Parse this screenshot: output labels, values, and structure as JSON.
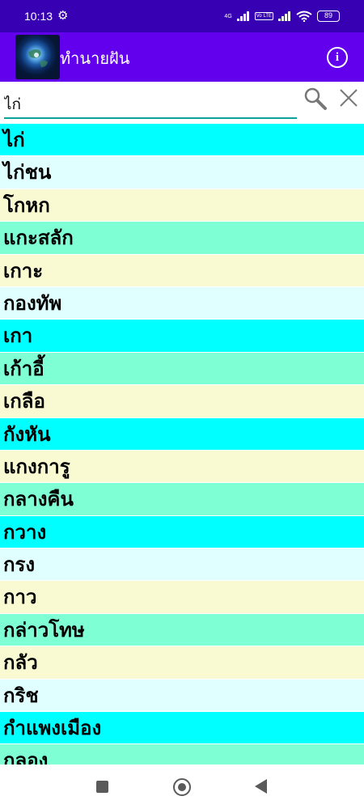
{
  "status_bar": {
    "time": "10:13",
    "gear_icon": "gear-icon",
    "network_label": "4G",
    "volte_label": "Vo LTE",
    "battery": "89"
  },
  "app_bar": {
    "title": "ทำนายฝัน",
    "info_icon": "info-icon",
    "info_glyph": "i",
    "logo_icon": "earth-icon"
  },
  "search": {
    "value": "ไก่",
    "search_icon": "search-icon",
    "close_icon": "close-icon"
  },
  "colors": {
    "status_bar": "#3700b3",
    "app_bar": "#6200ee",
    "accent_underline": "#0aa39a",
    "row_cyan": "#00ffff",
    "row_aqua": "#7fffd4",
    "row_light_cyan": "#e0ffff",
    "row_light_yellow": "#fafad2"
  },
  "words": [
    {
      "label": "ไก่",
      "color": "#00ffff"
    },
    {
      "label": "ไก่ชน",
      "color": "#e0ffff"
    },
    {
      "label": "โกหก",
      "color": "#fafad2"
    },
    {
      "label": "แกะสลัก",
      "color": "#7fffd4"
    },
    {
      "label": "เกาะ",
      "color": "#fafad2"
    },
    {
      "label": "กองทัพ",
      "color": "#e0ffff"
    },
    {
      "label": "เกา",
      "color": "#00ffff"
    },
    {
      "label": "เก้าอี้",
      "color": "#7fffd4"
    },
    {
      "label": "เกลือ",
      "color": "#fafad2"
    },
    {
      "label": "กังหัน",
      "color": "#00ffff"
    },
    {
      "label": "แกงการู",
      "color": "#fafad2"
    },
    {
      "label": "กลางคืน",
      "color": "#7fffd4"
    },
    {
      "label": "กวาง",
      "color": "#00ffff"
    },
    {
      "label": "กรง",
      "color": "#e0ffff"
    },
    {
      "label": "กาว",
      "color": "#fafad2"
    },
    {
      "label": "กล่าวโทษ",
      "color": "#7fffd4"
    },
    {
      "label": "กลัว",
      "color": "#fafad2"
    },
    {
      "label": "กริช",
      "color": "#e0ffff"
    },
    {
      "label": "กำแพงเมือง",
      "color": "#00ffff"
    },
    {
      "label": "กลอง",
      "color": "#7fffd4"
    }
  ],
  "nav_bar": {
    "recents_icon": "recents-square-icon",
    "home_icon": "home-circle-icon",
    "back_icon": "back-triangle-icon"
  }
}
